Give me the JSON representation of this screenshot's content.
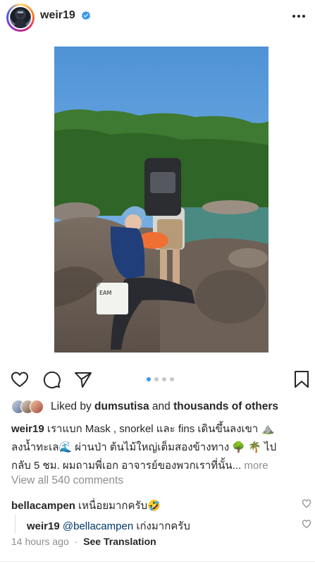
{
  "post": {
    "username": "weir19",
    "verified": true
  },
  "media": {
    "carousel_count": 4,
    "carousel_active": 1
  },
  "likes": {
    "prefix": "Liked by",
    "liker": "dumsutisa",
    "conj": "and",
    "others": "thousands of others"
  },
  "caption": {
    "username": "weir19",
    "line1": "เราแบก Mask , snorkel และ fins เดินขึ้นลงเขา ⛰️",
    "line2": "ลงน้ำทะเล🌊 ผ่านป่า ต้นไม้ใหญ่เต็มสองข้างทาง 🌳 🌴 ไป",
    "line3": "กลับ 5 ชม. ผมถามพี่เอก อาจารย์ของพวกเราที่นั้น...",
    "more": "more"
  },
  "comments": {
    "view_all": "View all 540 comments",
    "items": [
      {
        "username": "bellacampen",
        "text": "เหนื่อยมากครับ🤣"
      },
      {
        "username": "weir19",
        "mention": "@bellacampen",
        "text": "เก่งมากครับ"
      }
    ]
  },
  "footer": {
    "time": "14 hours ago",
    "separator": "·",
    "translate": "See Translation"
  },
  "icons": {
    "more": "more-horizontal-icon",
    "like": "heart-outline-icon",
    "comment": "comment-bubble-icon",
    "share": "paper-plane-icon",
    "save": "bookmark-outline-icon",
    "verified": "verified-badge-icon"
  },
  "colors": {
    "verified_blue": "#3897f0",
    "dot_active": "#3897f0",
    "dot_inactive": "#c7c7c7",
    "muted": "#8e8e8e",
    "mention": "#00376b"
  }
}
